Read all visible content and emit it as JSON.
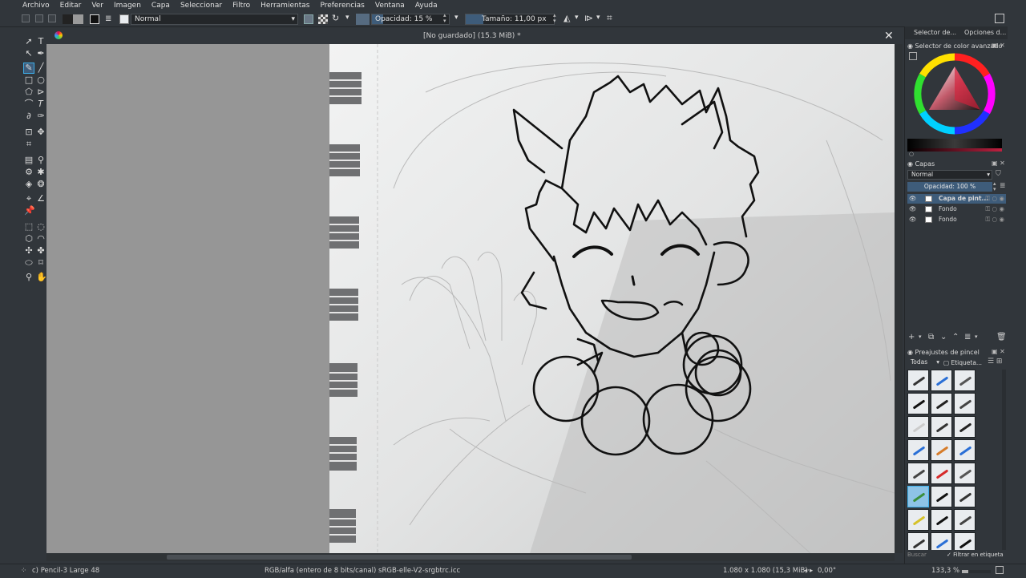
{
  "menu": [
    "Archivo",
    "Editar",
    "Ver",
    "Imagen",
    "Capa",
    "Seleccionar",
    "Filtro",
    "Herramientas",
    "Preferencias",
    "Ventana",
    "Ayuda"
  ],
  "toolbar": {
    "blend_mode": "Normal",
    "opacity_label": "Opacidad: 15 %",
    "opacity_value": 0.15,
    "size_label": "Tamaño: 11,00 px"
  },
  "document": {
    "title": "[No guardado]  (15.3 MiB) *",
    "close_icon": "close-icon"
  },
  "dockers": {
    "tab_selector": "Selector de...",
    "tab_options": "Opciones d...",
    "color_title": "Selector de color avanzado",
    "layers_title": "Capas",
    "layers_blend": "Normal",
    "layers_opacity": "Opacidad:  100 %",
    "layers": [
      {
        "name": "Capa de pint...",
        "active": true
      },
      {
        "name": "Fondo",
        "active": false
      },
      {
        "name": "Fondo",
        "active": false
      }
    ],
    "presets_title": "Preajustes de pincel",
    "presets_filter": "Todas",
    "presets_tag": "Etiqueta...",
    "search_placeholder": "Buscar",
    "filter_label": "Filtrar en etiqueta"
  },
  "status": {
    "brush": "c) Pencil-3 Large 48",
    "color_space": "RGB/alfa (entero de 8 bits/canal)  sRGB-elle-V2-srgbtrc.icc",
    "dimensions": "1.080 x 1.080 (15,3 MiB)",
    "rotation": "0,00°",
    "zoom": "133,3 %"
  },
  "colors": {
    "accent": "#3daee9",
    "panel": "#31363b",
    "canvas": "#969696"
  }
}
